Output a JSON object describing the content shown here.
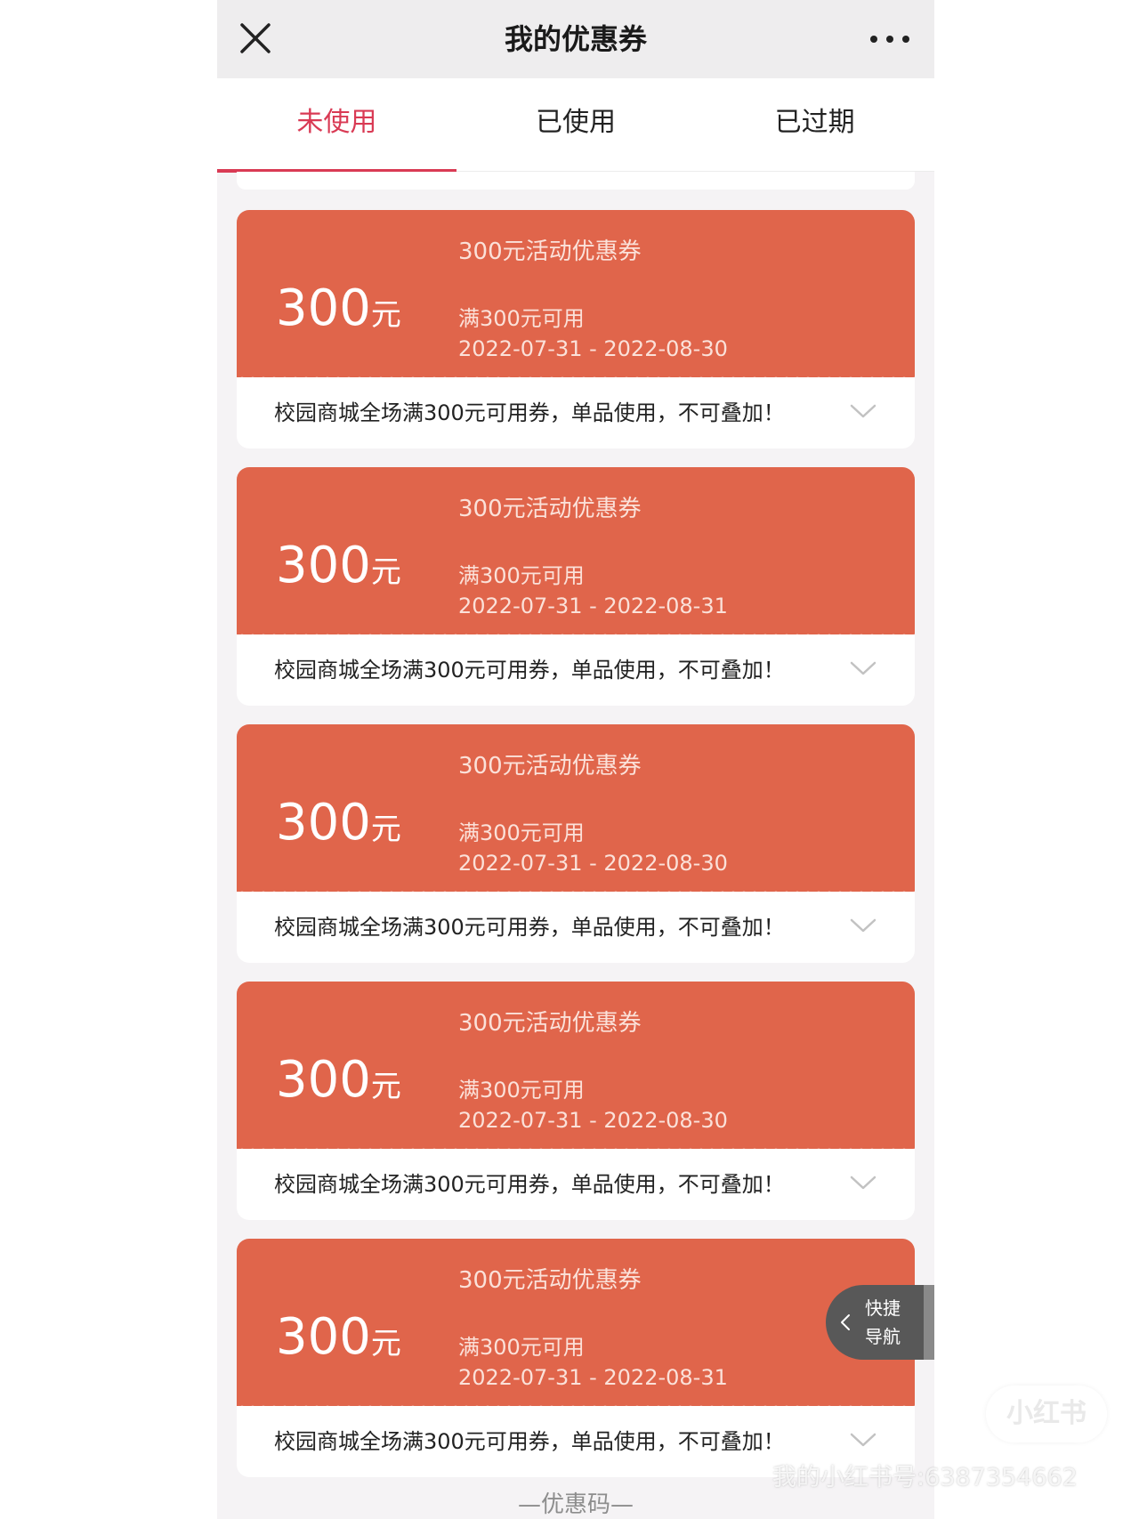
{
  "header": {
    "title": "我的优惠券"
  },
  "icons": {
    "close": "close-icon",
    "more": "more-icon",
    "chevron": "chevron-down-icon",
    "back": "chevron-left-icon"
  },
  "tabs": [
    {
      "label": "未使用",
      "active": true
    },
    {
      "label": "已使用",
      "active": false
    },
    {
      "label": "已过期",
      "active": false
    }
  ],
  "coupons": [
    {
      "amount": "300",
      "unit": "元",
      "name": "300元活动优惠券",
      "condition": "满300元可用",
      "date_range": "2022-07-31 - 2022-08-30",
      "description": "校园商城全场满300元可用券，单品使用，不可叠加！"
    },
    {
      "amount": "300",
      "unit": "元",
      "name": "300元活动优惠券",
      "condition": "满300元可用",
      "date_range": "2022-07-31 - 2022-08-31",
      "description": "校园商城全场满300元可用券，单品使用，不可叠加！"
    },
    {
      "amount": "300",
      "unit": "元",
      "name": "300元活动优惠券",
      "condition": "满300元可用",
      "date_range": "2022-07-31 - 2022-08-30",
      "description": "校园商城全场满300元可用券，单品使用，不可叠加！"
    },
    {
      "amount": "300",
      "unit": "元",
      "name": "300元活动优惠券",
      "condition": "满300元可用",
      "date_range": "2022-07-31 - 2022-08-30",
      "description": "校园商城全场满300元可用券，单品使用，不可叠加！"
    },
    {
      "amount": "300",
      "unit": "元",
      "name": "300元活动优惠券",
      "condition": "满300元可用",
      "date_range": "2022-07-31 - 2022-08-31",
      "description": "校园商城全场满300元可用券，单品使用，不可叠加！"
    }
  ],
  "quick_nav": {
    "line1": "快捷",
    "line2": "导航"
  },
  "coupon_code_heading": "—优惠码—",
  "watermark": {
    "logo": "小红书",
    "id": "我的小红书号:6387354662"
  },
  "colors": {
    "accent": "#d93a54",
    "coupon": "#e0654b",
    "background": "#f5f3f5"
  }
}
